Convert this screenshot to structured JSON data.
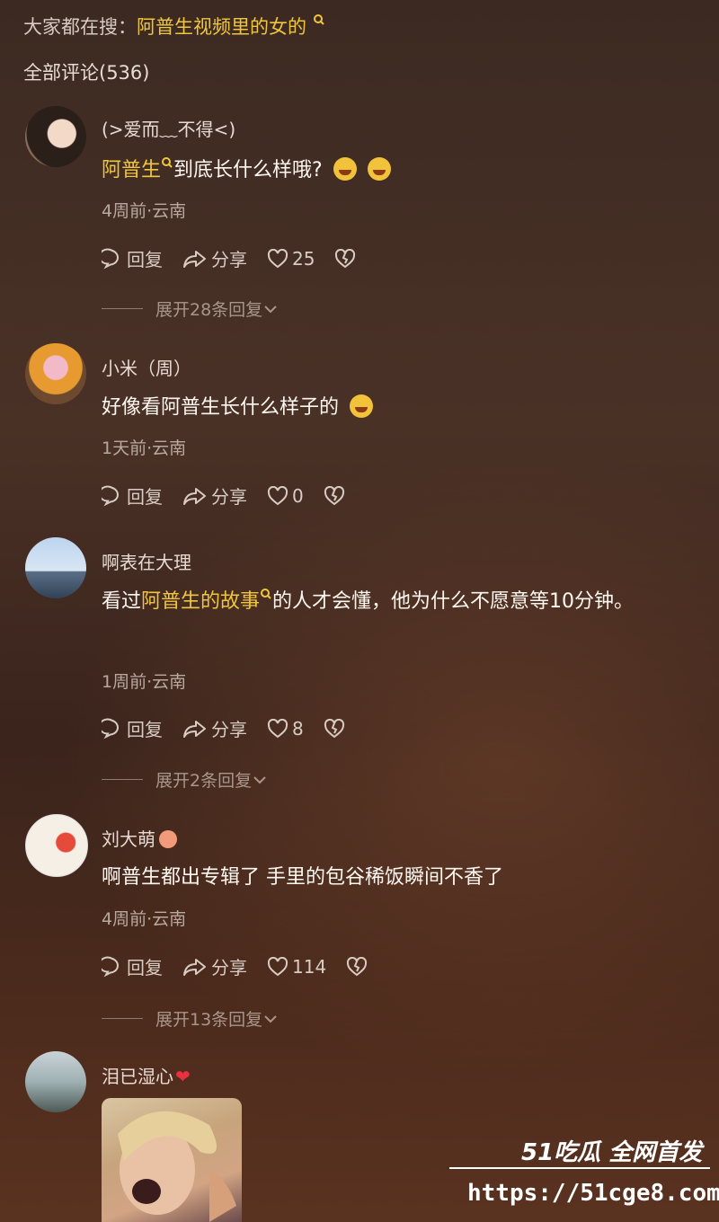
{
  "search": {
    "prefix": "大家都在搜：",
    "query": "阿普生视频里的女的"
  },
  "comments_count": "全部评论(536)",
  "labels": {
    "reply": "回复",
    "share": "分享"
  },
  "comments": [
    {
      "user": "(>爱而﹏不得<)",
      "text_hl": "阿普生",
      "text": "到底长什么样哦?",
      "meta": "4周前·云南",
      "likes": "25",
      "expand": "展开28条回复"
    },
    {
      "user": "小米（周）",
      "text": "好像看阿普生长什么样子的",
      "meta": "1天前·云南",
      "likes": "0"
    },
    {
      "user": "啊表在大理",
      "text_pre": "看过",
      "text_hl": "阿普生的故事",
      "text": "的人才会懂，他为什么不愿意等10分钟。",
      "meta": "1周前·云南",
      "likes": "8",
      "expand": "展开2条回复"
    },
    {
      "user": "刘大萌",
      "text": "啊普生都出专辑了  手里的包谷稀饭瞬间不香了",
      "meta": "4周前·云南",
      "likes": "114",
      "expand": "展开13条回复"
    },
    {
      "user": "泪已湿心"
    }
  ],
  "watermark": {
    "brand": "51吃瓜 全网首发",
    "url": "https://51cge8.com"
  }
}
